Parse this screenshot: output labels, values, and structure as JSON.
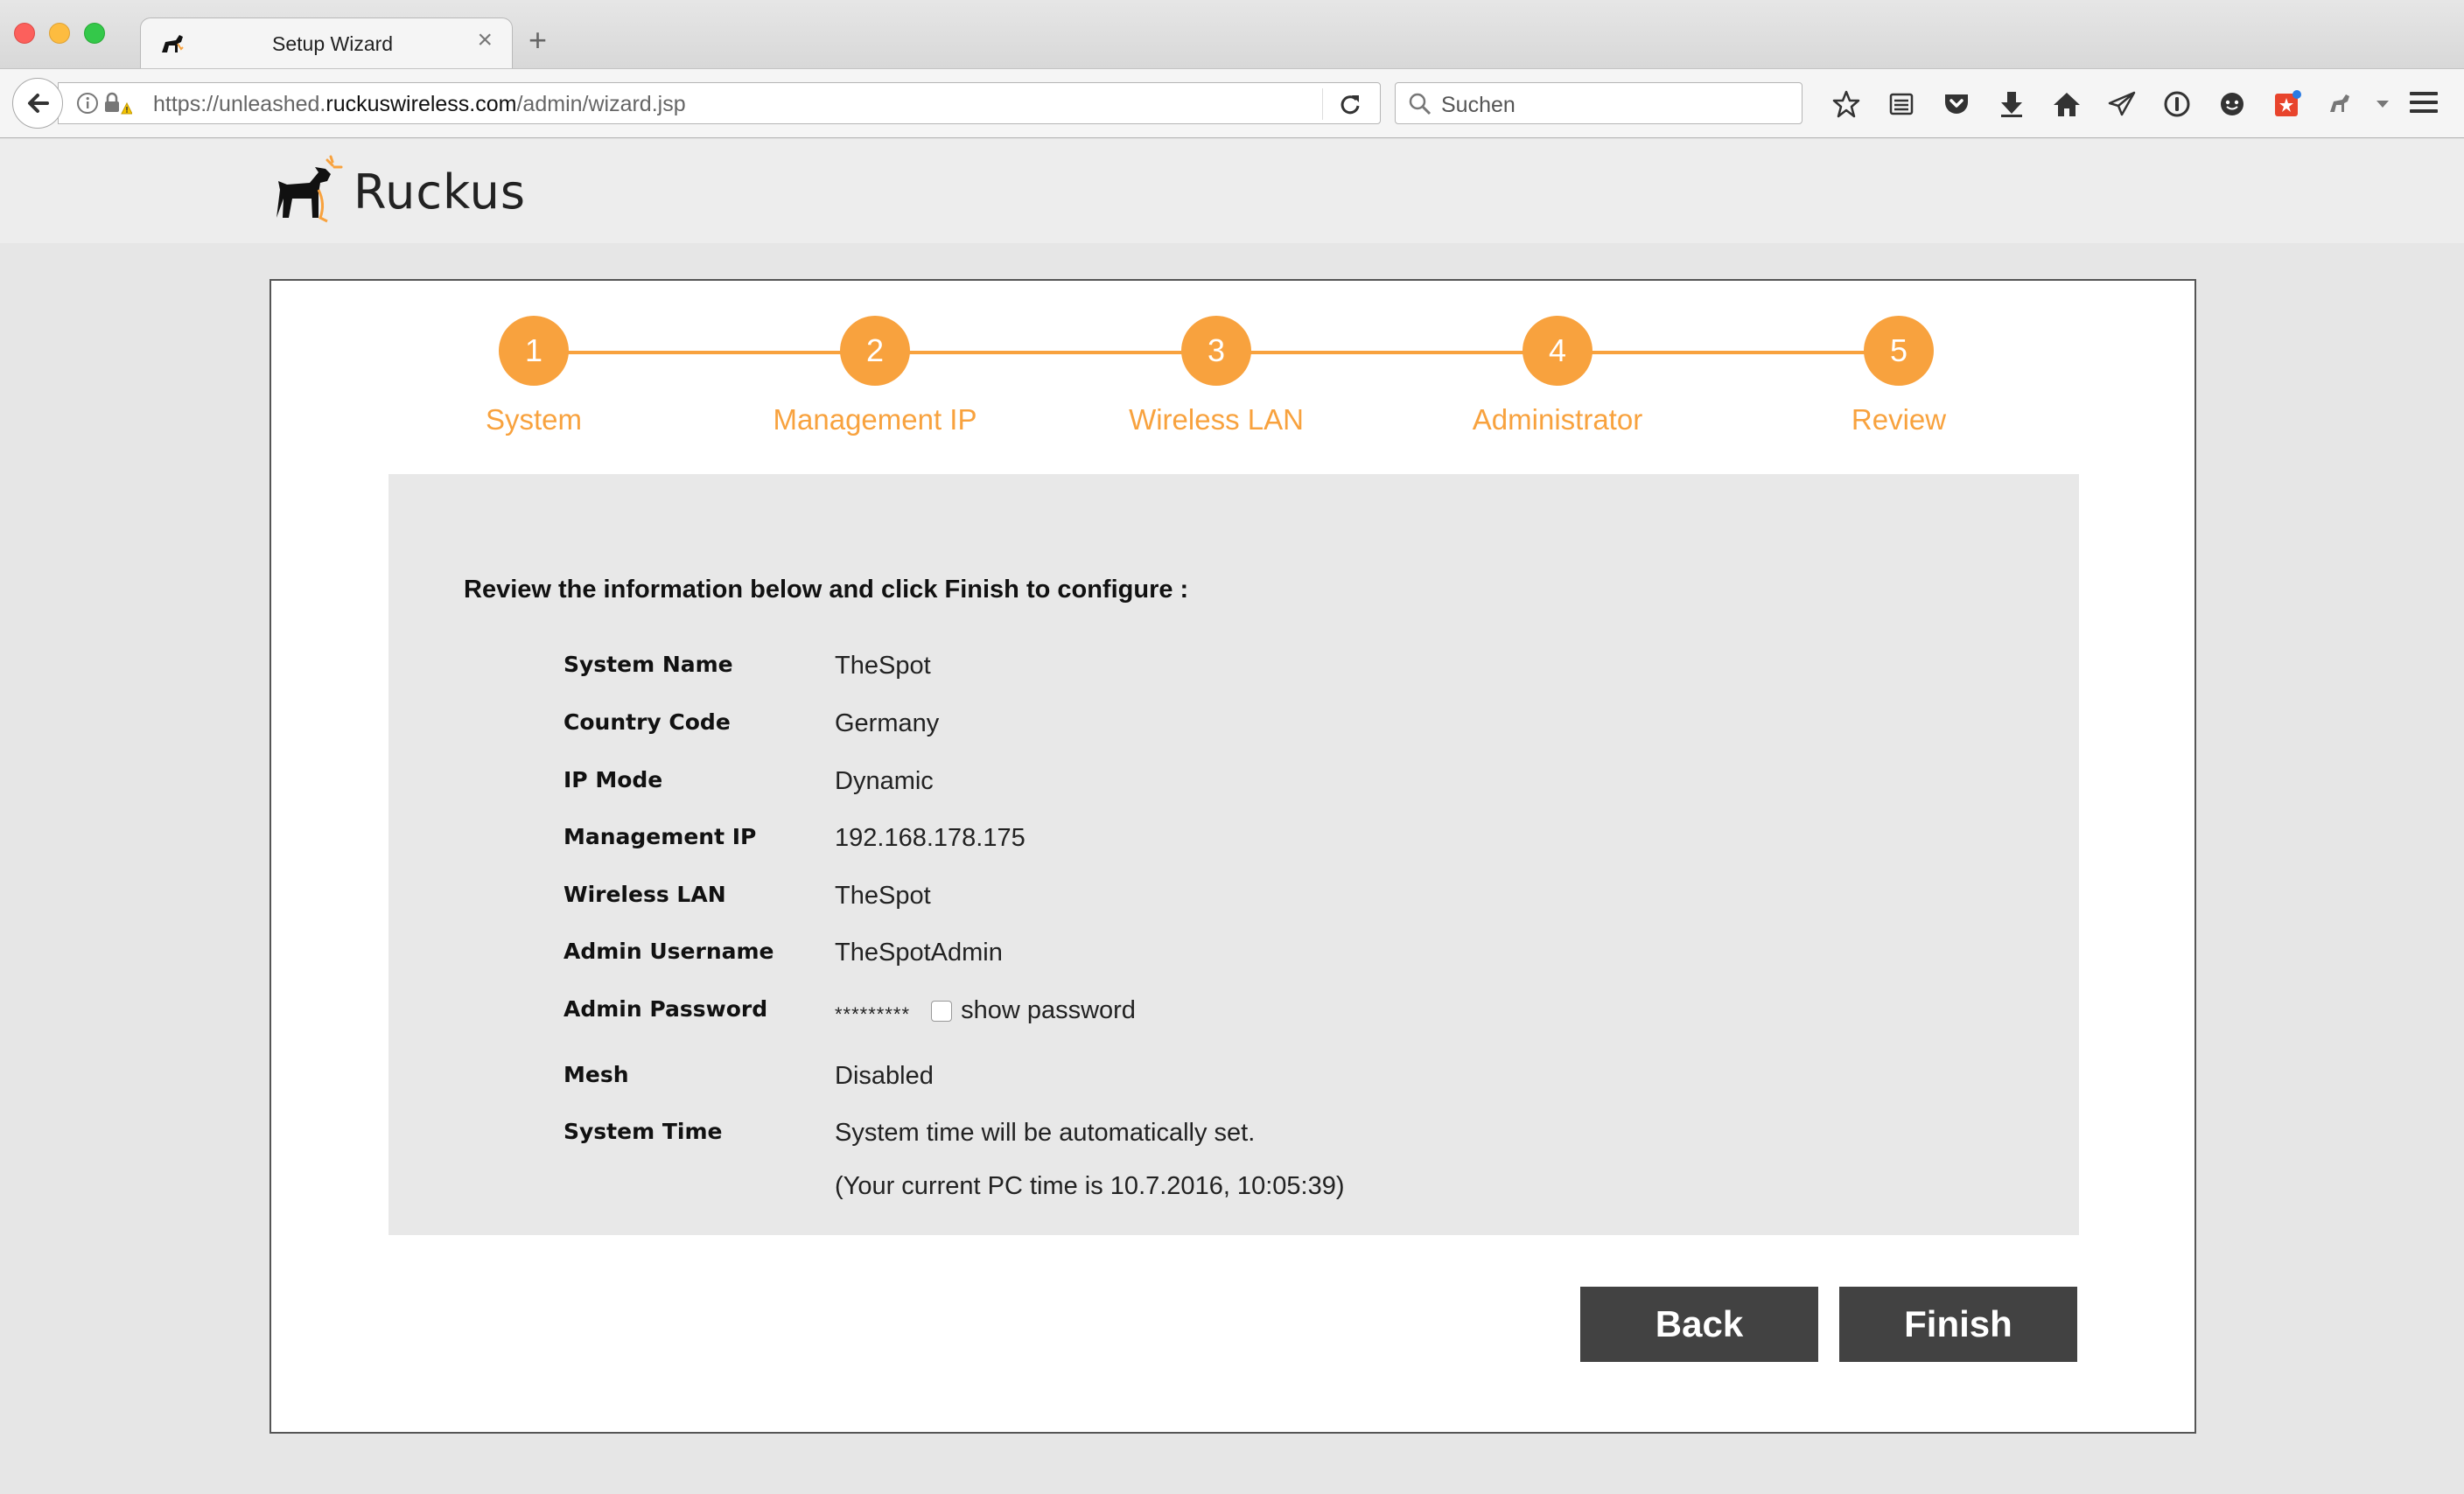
{
  "browser": {
    "tab_title": "Setup Wizard",
    "tab_close": "×",
    "new_tab": "+",
    "url_prefix": "https://unleashed.",
    "url_domain": "ruckuswireless.com",
    "url_path": "/admin/wizard.jsp",
    "search_placeholder": "Suchen",
    "toolbar_icons": [
      "bookmark-star-icon",
      "reading-list-icon",
      "pocket-icon",
      "download-icon",
      "home-icon",
      "send-icon",
      "onepassword-icon",
      "chat-icon",
      "extension-badge-icon",
      "extension-icon",
      "overflow-chevron-icon"
    ]
  },
  "brand": {
    "name": "Ruckus"
  },
  "steps": [
    {
      "number": "1",
      "label": "System"
    },
    {
      "number": "2",
      "label": "Management IP"
    },
    {
      "number": "3",
      "label": "Wireless LAN"
    },
    {
      "number": "4",
      "label": "Administrator"
    },
    {
      "number": "5",
      "label": "Review"
    }
  ],
  "review": {
    "intro": "Review the information below and click Finish to configure :",
    "rows": [
      {
        "label": "System Name",
        "value": "TheSpot"
      },
      {
        "label": "Country Code",
        "value": "Germany"
      },
      {
        "label": "IP Mode",
        "value": "Dynamic"
      },
      {
        "label": "Management IP",
        "value": "192.168.178.175"
      },
      {
        "label": "Wireless LAN",
        "value": "TheSpot"
      },
      {
        "label": "Admin Username",
        "value": "TheSpotAdmin"
      },
      {
        "label": "Admin Password",
        "value": "*********",
        "checkbox_label": "show password"
      },
      {
        "label": "Mesh",
        "value": "Disabled"
      },
      {
        "label": "System Time",
        "value": "System time will be automatically set.",
        "note": "(Your current PC time is 10.7.2016, 10:05:39)"
      }
    ]
  },
  "buttons": {
    "back": "Back",
    "finish": "Finish"
  },
  "colors": {
    "accent": "#f8a23e",
    "button": "#424242",
    "review_bg": "#e8e8e8"
  }
}
